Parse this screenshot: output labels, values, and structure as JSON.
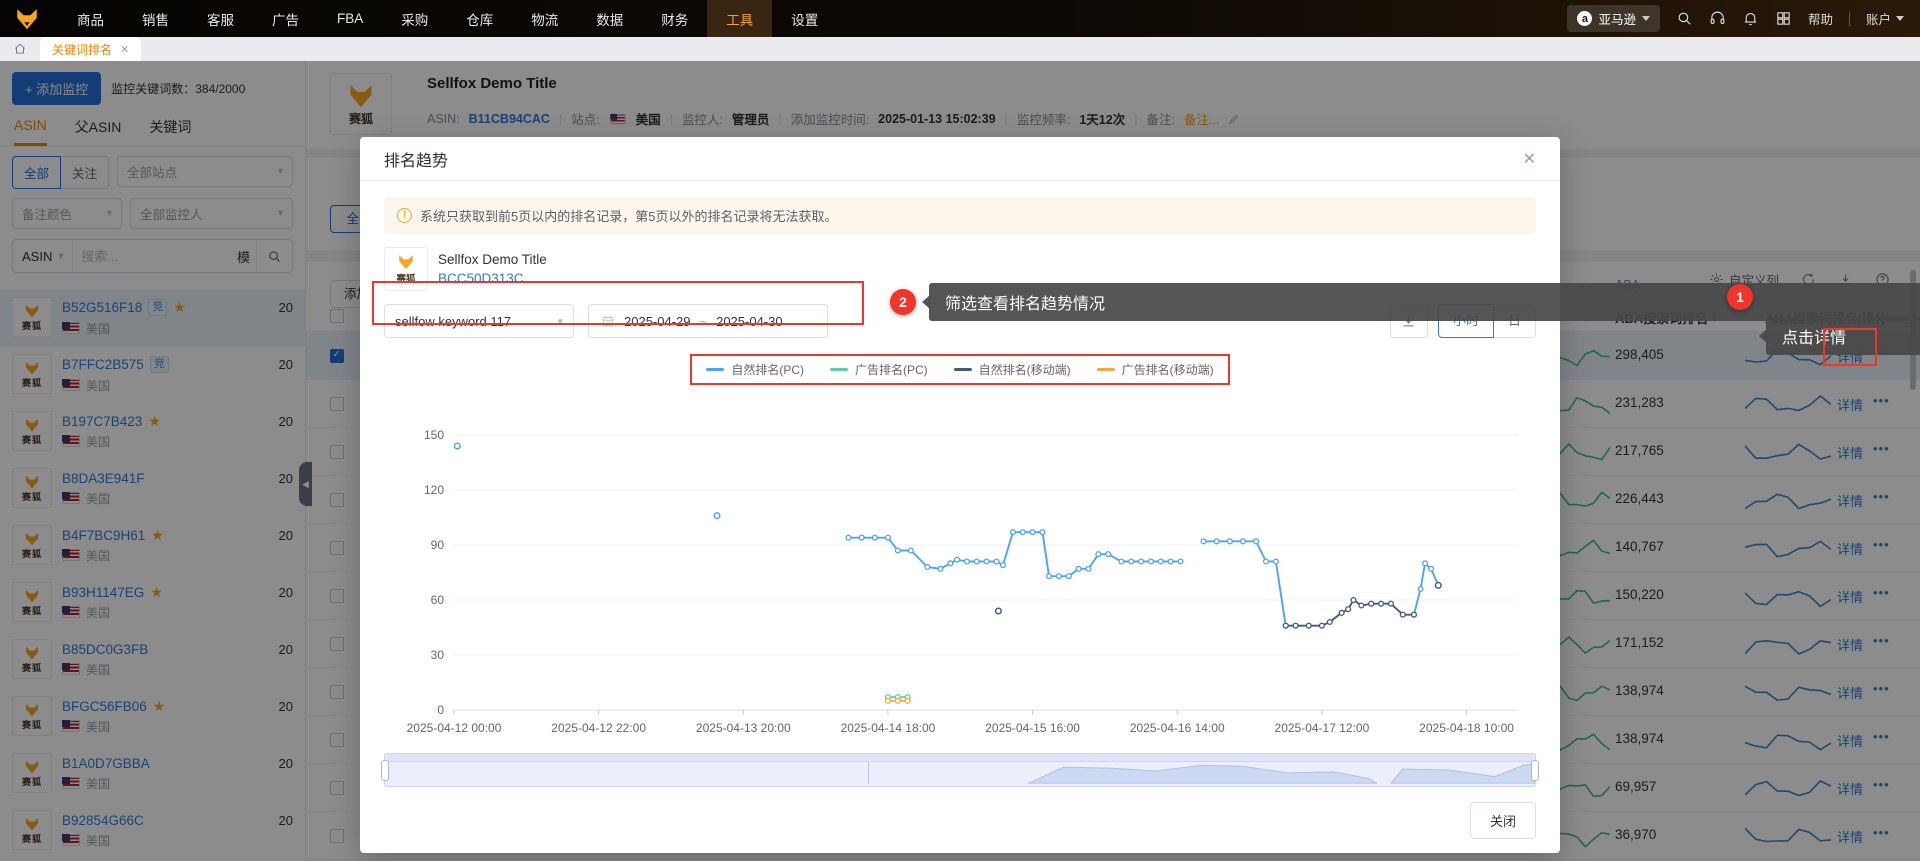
{
  "topnav": {
    "menu": [
      "商品",
      "销售",
      "客服",
      "广告",
      "FBA",
      "采购",
      "仓库",
      "物流",
      "数据",
      "财务",
      "工具",
      "设置"
    ],
    "active_item": "工具",
    "marketplace": "亚马逊",
    "help_label": "帮助",
    "account_label": "账户"
  },
  "tabbar": {
    "active_tab": "关键词排名"
  },
  "sidebar": {
    "add_button": "+ 添加监控",
    "count_label": "监控关键词数：384/2000",
    "tabs": [
      "ASIN",
      "父ASIN",
      "关键词"
    ],
    "active_tab": "ASIN",
    "filters": {
      "scope": [
        "全部",
        "关注"
      ],
      "scope_active": "全部",
      "site_placeholder": "全部站点",
      "color_placeholder": "备注颜色",
      "monitor_placeholder": "全部监控人"
    },
    "search": {
      "type": "ASIN",
      "placeholder": "搜索...",
      "mode": "模"
    },
    "items": [
      {
        "asin": "B52G516F18",
        "badge": "竞",
        "starred": true,
        "site": "美国",
        "value": "20",
        "selected": true
      },
      {
        "asin": "B7FFC2B575",
        "badge": "竞",
        "starred": false,
        "site": "美国",
        "value": "20",
        "selected": false
      },
      {
        "asin": "B197C7B423",
        "badge": "",
        "starred": true,
        "site": "美国",
        "value": "20",
        "selected": false
      },
      {
        "asin": "B8DA3E941F",
        "badge": "",
        "starred": false,
        "site": "美国",
        "value": "20",
        "selected": false
      },
      {
        "asin": "B4F7BC9H61",
        "badge": "",
        "starred": true,
        "site": "美国",
        "value": "20",
        "selected": false
      },
      {
        "asin": "B93H1147EG",
        "badge": "",
        "starred": true,
        "site": "美国",
        "value": "20",
        "selected": false
      },
      {
        "asin": "B85DC0G3FB",
        "badge": "",
        "starred": false,
        "site": "美国",
        "value": "20",
        "selected": false
      },
      {
        "asin": "BFGC56FB06",
        "badge": "",
        "starred": true,
        "site": "美国",
        "value": "20",
        "selected": false
      },
      {
        "asin": "B1A0D7GBBA",
        "badge": "",
        "starred": false,
        "site": "美国",
        "value": "20",
        "selected": false
      },
      {
        "asin": "B92854G66C",
        "badge": "",
        "starred": false,
        "site": "美国",
        "value": "20",
        "selected": false
      }
    ]
  },
  "background": {
    "product": {
      "title": "Sellfox Demo Title",
      "thumb": "赛狐",
      "asin_label": "ASIN:",
      "asin": "B11CB94CAC",
      "site_label": "站点:",
      "site": "美国",
      "monitor_label": "监控人:",
      "monitor": "管理员",
      "added_label": "添加监控时间:",
      "added": "2025-01-13 15:02:39",
      "freq_label": "监控频率:",
      "freq": "1天12次",
      "note_label": "备注:",
      "note": "备注..."
    },
    "partial_buttons": [
      "全部",
      "添加监控"
    ],
    "table": {
      "group_label": "ABA",
      "customize_label": "自定义列",
      "columns": [
        "ABA搜索词排名",
        "ABA搜索词排名趋",
        "操作"
      ],
      "action_label": "详情",
      "more_label": "•••",
      "rows": [
        {
          "value": "298,405"
        },
        {
          "value": "231,283"
        },
        {
          "value": "217,765"
        },
        {
          "value": "226,443"
        },
        {
          "value": "140,767"
        },
        {
          "value": "150,220"
        },
        {
          "value": "171,152"
        },
        {
          "value": "138,974"
        },
        {
          "value": "138,974"
        },
        {
          "value": "69,957"
        },
        {
          "value": "36,970"
        }
      ]
    }
  },
  "modal": {
    "title": "排名趋势",
    "warning": "系统只获取到前5页以内的排名记录，第5页以外的排名记录将无法获取。",
    "product": {
      "title": "Sellfox Demo Title",
      "sku": "BCC50D313C",
      "thumb": "赛狐"
    },
    "keyword_select": "sellfow keyword 117",
    "date_range": {
      "start": "2025-04-29",
      "sep": "~",
      "end": "2025-04-30"
    },
    "granularity": {
      "options": [
        "小时",
        "日"
      ],
      "active": "小时"
    },
    "close_label": "关闭"
  },
  "annotations": {
    "step1": {
      "number": "1",
      "tooltip": "点击详情"
    },
    "step2": {
      "number": "2",
      "tooltip": "筛选查看排名趋势情况"
    }
  },
  "chart_data": {
    "type": "line",
    "title": "排名趋势",
    "xlabel": "",
    "ylabel": "",
    "ylim": [
      0,
      150
    ],
    "yticks": [
      0,
      30,
      60,
      90,
      120,
      150
    ],
    "x_range": [
      0,
      160
    ],
    "xtick_hours": [
      0,
      22,
      44,
      66,
      88,
      110,
      132,
      154
    ],
    "xticks": [
      "2025-04-12 00:00",
      "2025-04-12 22:00",
      "2025-04-13 20:00",
      "2025-04-14 18:00",
      "2025-04-15 16:00",
      "2025-04-16 14:00",
      "2025-04-17 12:00",
      "2025-04-18 10:00"
    ],
    "grid": true,
    "legend_position": "top-center",
    "series": [
      {
        "name": "自然排名(PC)",
        "color": "#4da3f5",
        "dots": [
          [
            0.5,
            144
          ],
          [
            40,
            106
          ]
        ],
        "segments": [
          [
            [
              60,
              94
            ],
            [
              62,
              94
            ],
            [
              64,
              94
            ],
            [
              66,
              94
            ],
            [
              67.5,
              87
            ],
            [
              69.5,
              87
            ],
            [
              72,
              78
            ],
            [
              74,
              77
            ],
            [
              75.5,
              80
            ],
            [
              76.5,
              82
            ],
            [
              78,
              81
            ],
            [
              79.5,
              81
            ],
            [
              81,
              81
            ],
            [
              82.5,
              81
            ],
            [
              83.5,
              79
            ],
            [
              85,
              97
            ],
            [
              86.5,
              97
            ],
            [
              88,
              97
            ],
            [
              89.5,
              97
            ],
            [
              90.5,
              73
            ],
            [
              92,
              73
            ],
            [
              93.5,
              73
            ],
            [
              95,
              77
            ],
            [
              96.5,
              77
            ],
            [
              98,
              85
            ],
            [
              99.5,
              85
            ],
            [
              101.5,
              81
            ],
            [
              103,
              81
            ],
            [
              104.5,
              81
            ],
            [
              106,
              81
            ],
            [
              107.5,
              81
            ],
            [
              109,
              81
            ],
            [
              110.5,
              81
            ]
          ],
          [
            [
              114,
              92
            ],
            [
              116,
              92
            ],
            [
              118,
              92
            ],
            [
              120,
              92
            ],
            [
              122,
              92
            ],
            [
              123.5,
              81
            ],
            [
              125,
              81
            ],
            [
              126.5,
              46
            ]
          ],
          [
            [
              146,
              52
            ],
            [
              147,
              66
            ],
            [
              147.7,
              80
            ],
            [
              148.6,
              77
            ],
            [
              149.7,
              68
            ]
          ]
        ]
      },
      {
        "name": "广告排名(PC)",
        "color": "#58d0a5",
        "dots": [],
        "segments": [
          [
            [
              66,
              7
            ],
            [
              67.5,
              7
            ],
            [
              69,
              7
            ]
          ]
        ]
      },
      {
        "name": "自然排名(移动端)",
        "color": "#44597c",
        "dots": [
          [
            82.8,
            54
          ],
          [
            149.7,
            68
          ]
        ],
        "segments": [
          [
            [
              126.5,
              46
            ],
            [
              128,
              46
            ],
            [
              130,
              46
            ],
            [
              132,
              46
            ],
            [
              133.2,
              48
            ],
            [
              135,
              53
            ],
            [
              136,
              55
            ],
            [
              136.8,
              60
            ],
            [
              138,
              57
            ],
            [
              139.5,
              58
            ],
            [
              141,
              58
            ],
            [
              142.5,
              58
            ],
            [
              144.3,
              52
            ],
            [
              146,
              52
            ]
          ]
        ]
      },
      {
        "name": "广告排名(移动端)",
        "color": "#f3a93c",
        "dots": [],
        "segments": [
          [
            [
              66,
              5
            ],
            [
              67.5,
              5
            ],
            [
              69,
              5
            ]
          ]
        ]
      }
    ]
  }
}
